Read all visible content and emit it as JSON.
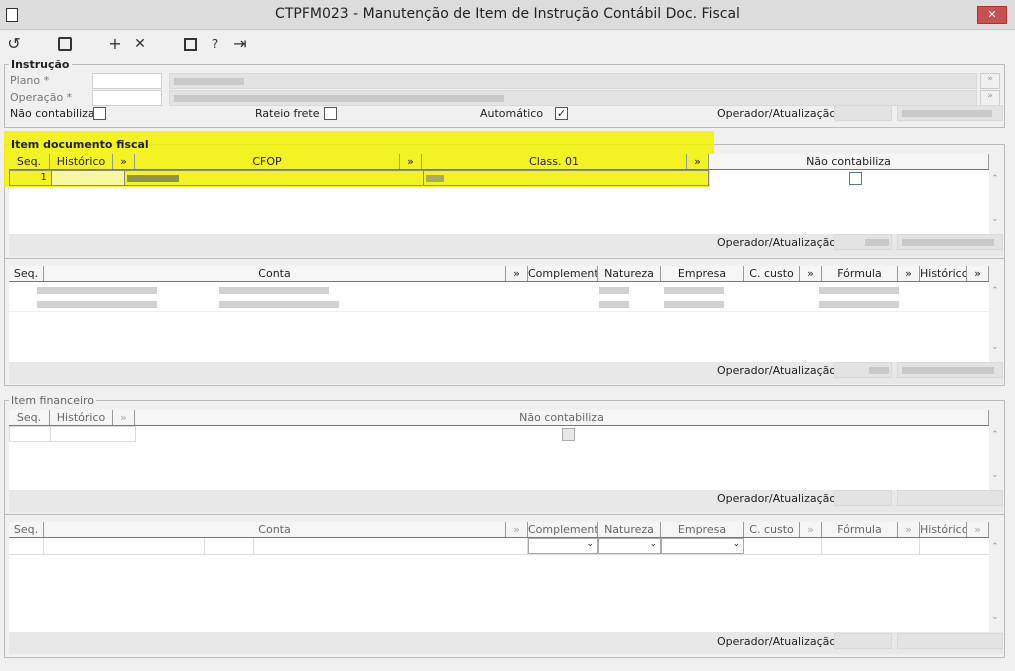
{
  "window": {
    "title": "CTPFM023 - Manutenção de Item de Instrução Contábil Doc. Fiscal",
    "close": "✕"
  },
  "toolbar": {
    "undo": "↺",
    "save": "💾",
    "add": "+",
    "remove": "✕",
    "calendar": "▦",
    "help": "?",
    "exit": "⇥"
  },
  "instrucao": {
    "legend": "Instrução",
    "plano_label": "Plano *",
    "operacao_label": "Operação *",
    "nao_contabiliza": "Não contabiliza",
    "rateio_frete": "Rateio frete",
    "automatico": "Automático",
    "automatico_checked": true,
    "operador": "Operador/Atualização"
  },
  "item_doc": {
    "legend": "Item documento fiscal",
    "cols": [
      "Seq.",
      "Histórico",
      "»",
      "CFOP",
      "»",
      "Class. 01",
      "»",
      "Não contabiliza"
    ],
    "row_seq": "1",
    "operador": "Operador/Atualização"
  },
  "contas1": {
    "cols": [
      "Seq.",
      "Conta",
      "»",
      "Complemento",
      "Natureza",
      "Empresa",
      "C. custo",
      "»",
      "Fórmula",
      "»",
      "Histórico",
      "»"
    ],
    "operador": "Operador/Atualização"
  },
  "item_fin": {
    "legend": "Item financeiro",
    "cols": [
      "Seq.",
      "Histórico",
      "",
      "Não contabiliza"
    ],
    "operador": "Operador/Atualização"
  },
  "contas2": {
    "cols": [
      "Seq.",
      "Conta",
      "",
      "Complemento",
      "Natureza",
      "Empresa",
      "C. custo",
      "",
      "Fórmula",
      "",
      "Histórico",
      ""
    ],
    "operador": "Operador/Atualização"
  },
  "colors": {
    "highlight": "#f3f300",
    "close_bg": "#c75050"
  }
}
